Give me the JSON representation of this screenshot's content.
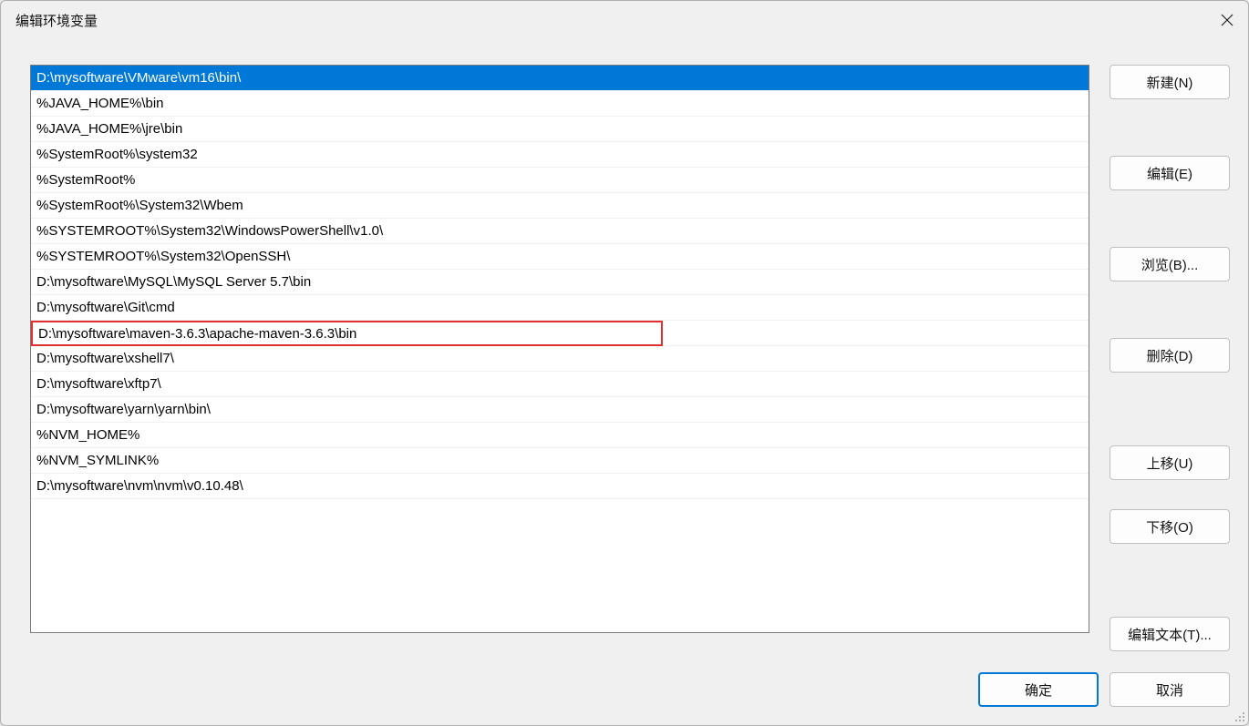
{
  "title": "编辑环境变量",
  "list_items": [
    {
      "text": "D:\\mysoftware\\VMware\\vm16\\bin\\",
      "selected": true,
      "highlighted": false
    },
    {
      "text": "%JAVA_HOME%\\bin",
      "selected": false,
      "highlighted": false
    },
    {
      "text": "%JAVA_HOME%\\jre\\bin",
      "selected": false,
      "highlighted": false
    },
    {
      "text": "%SystemRoot%\\system32",
      "selected": false,
      "highlighted": false
    },
    {
      "text": "%SystemRoot%",
      "selected": false,
      "highlighted": false
    },
    {
      "text": "%SystemRoot%\\System32\\Wbem",
      "selected": false,
      "highlighted": false
    },
    {
      "text": "%SYSTEMROOT%\\System32\\WindowsPowerShell\\v1.0\\",
      "selected": false,
      "highlighted": false
    },
    {
      "text": "%SYSTEMROOT%\\System32\\OpenSSH\\",
      "selected": false,
      "highlighted": false
    },
    {
      "text": "D:\\mysoftware\\MySQL\\MySQL Server 5.7\\bin",
      "selected": false,
      "highlighted": false
    },
    {
      "text": "D:\\mysoftware\\Git\\cmd",
      "selected": false,
      "highlighted": false
    },
    {
      "text": "D:\\mysoftware\\maven-3.6.3\\apache-maven-3.6.3\\bin",
      "selected": false,
      "highlighted": true
    },
    {
      "text": "D:\\mysoftware\\xshell7\\",
      "selected": false,
      "highlighted": false
    },
    {
      "text": "D:\\mysoftware\\xftp7\\",
      "selected": false,
      "highlighted": false
    },
    {
      "text": "D:\\mysoftware\\yarn\\yarn\\bin\\",
      "selected": false,
      "highlighted": false
    },
    {
      "text": "%NVM_HOME%",
      "selected": false,
      "highlighted": false
    },
    {
      "text": "%NVM_SYMLINK%",
      "selected": false,
      "highlighted": false
    },
    {
      "text": "D:\\mysoftware\\nvm\\nvm\\v0.10.48\\",
      "selected": false,
      "highlighted": false
    }
  ],
  "buttons": {
    "new": "新建(N)",
    "edit": "编辑(E)",
    "browse": "浏览(B)...",
    "delete": "删除(D)",
    "move_up": "上移(U)",
    "move_down": "下移(O)",
    "edit_text": "编辑文本(T)...",
    "ok": "确定",
    "cancel": "取消"
  }
}
